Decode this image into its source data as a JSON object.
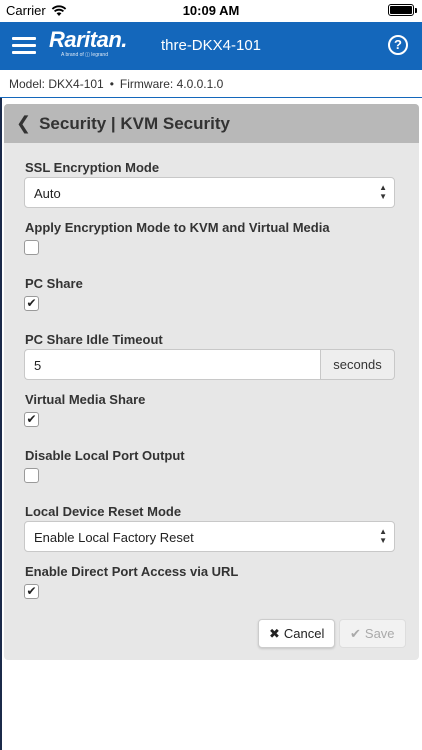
{
  "status_bar": {
    "carrier": "Carrier",
    "time": "10:09 AM"
  },
  "header": {
    "brand": "Raritan.",
    "brand_sub": "A brand of ◫ legrand",
    "device_title": "thre-DKX4-101",
    "help": "?"
  },
  "info": {
    "model": "Model: DKX4-101",
    "separator": "•",
    "firmware": "Firmware: 4.0.0.1.0"
  },
  "panel": {
    "back": "❮",
    "title": "Security | KVM Security",
    "ssl_mode": {
      "label": "SSL Encryption Mode",
      "value": "Auto"
    },
    "apply_encryption": {
      "label": "Apply Encryption Mode to KVM and Virtual Media",
      "checked": false
    },
    "pc_share": {
      "label": "PC Share",
      "checked": true
    },
    "pc_share_timeout": {
      "label": "PC Share Idle Timeout",
      "value": "5",
      "unit": "seconds"
    },
    "virtual_media_share": {
      "label": "Virtual Media Share",
      "checked": true
    },
    "disable_local_port": {
      "label": "Disable Local Port Output",
      "checked": false
    },
    "reset_mode": {
      "label": "Local Device Reset Mode",
      "value": "Enable Local Factory Reset"
    },
    "direct_port_access": {
      "label": "Enable Direct Port Access via URL",
      "checked": true
    },
    "cancel_label": "Cancel",
    "save_label": "Save"
  },
  "icons": {
    "check": "✔",
    "cancel": "✖",
    "select_arrows": "▲▼"
  },
  "colors": {
    "header_bg": "#1467bb",
    "panel_bg": "#e7e7e7",
    "panel_header_bg": "#b8b8b8"
  }
}
